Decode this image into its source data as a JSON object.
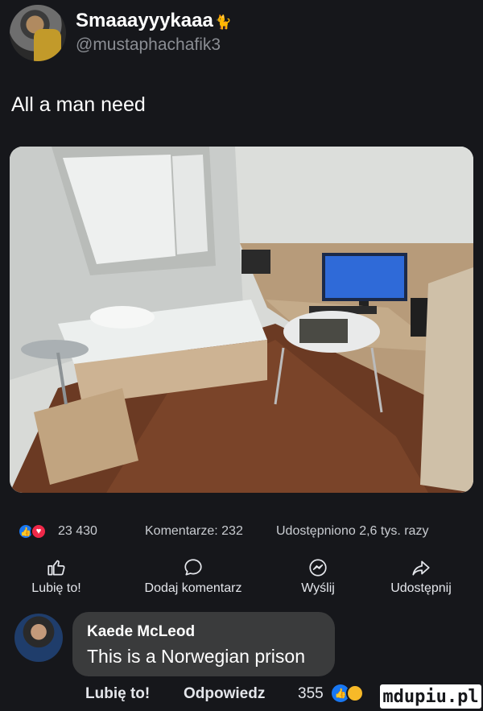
{
  "tweet": {
    "display_name": "Smaaayyykaaa",
    "badge_emoji": "🐈",
    "handle": "@mustaphachafik3",
    "text": "All a man need"
  },
  "photo": {
    "icon": "dorm-room-photo"
  },
  "post_stats": {
    "reactions": "23 430",
    "comments": "Komentarze: 232",
    "shares": "Udostępniono 2,6 tys. razy"
  },
  "actions": {
    "like": "Lubię to!",
    "comment": "Dodaj komentarz",
    "send": "Wyślij",
    "share": "Udostępnij"
  },
  "comment": {
    "author": "Kaede McLeod",
    "text": "This is a Norwegian prison",
    "like": "Lubię to!",
    "reply": "Odpowiedz",
    "reaction_count": "355"
  },
  "watermark": "mdupiu.pl",
  "colors": {
    "background": "#16171b",
    "like_blue": "#1877f2",
    "love_red": "#f02849",
    "bubble": "#3a3b3c"
  }
}
